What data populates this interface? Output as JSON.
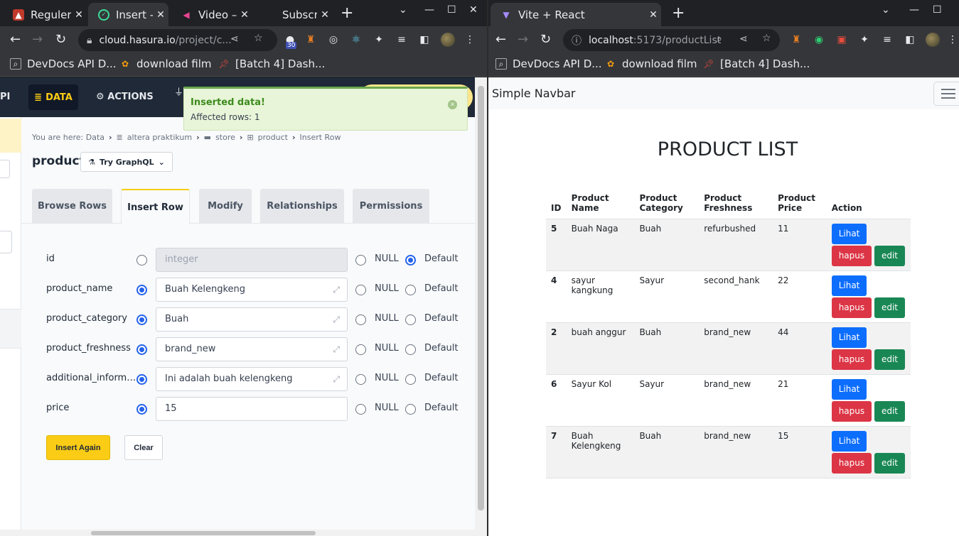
{
  "left_window": {
    "tabs": [
      {
        "title": "Reguler",
        "active": false
      },
      {
        "title": "Insert -",
        "active": true
      },
      {
        "title": "Video –",
        "active": false
      },
      {
        "title": "Subscri",
        "active": false
      }
    ],
    "url_main": "cloud.hasura.io",
    "url_rest": "/project/c...",
    "extension_badge": "30",
    "bookmarks": [
      "DevDocs API D...",
      "download film",
      "[Batch 4] Dash..."
    ]
  },
  "right_window": {
    "tabs": [
      {
        "title": "Vite + React",
        "active": true
      }
    ],
    "url_main": "localhost",
    "url_rest": ":5173/productList",
    "bookmarks": [
      "DevDocs API D...",
      "download film",
      "[Batch 4] Dash..."
    ]
  },
  "hasura": {
    "nav": {
      "api": "PI",
      "data": "DATA",
      "actions": "ACTIONS"
    },
    "toast": {
      "title": "Inserted data!",
      "message": "Affected rows: 1"
    },
    "breadcrumb": [
      "You are here: Data",
      "altera praktikum",
      "store",
      "product",
      "Insert Row"
    ],
    "table_title": "product",
    "try_graphql": "Try GraphQL",
    "tabs": [
      "Browse Rows",
      "Insert Row",
      "Modify",
      "Relationships",
      "Permissions"
    ],
    "active_tab": "Insert Row",
    "fields": [
      {
        "name": "id",
        "value": "",
        "placeholder": "integer",
        "mode": "Default"
      },
      {
        "name": "product_name",
        "value": "Buah Kelengkeng",
        "placeholder": "",
        "mode": "value"
      },
      {
        "name": "product_category",
        "value": "Buah",
        "placeholder": "",
        "mode": "value"
      },
      {
        "name": "product_freshness",
        "value": "brand_new",
        "placeholder": "",
        "mode": "value"
      },
      {
        "name": "additional_informat...",
        "value": "Ini adalah buah kelengkeng",
        "placeholder": "",
        "mode": "value"
      },
      {
        "name": "price",
        "value": "15",
        "placeholder": "",
        "mode": "value"
      }
    ],
    "null_label": "NULL",
    "default_label": "Default",
    "insert_again": "Insert Again",
    "clear": "Clear"
  },
  "react": {
    "brand": "Simple Navbar",
    "page_title": "PRODUCT LIST",
    "headers": [
      "ID",
      "Product Name",
      "Product Category",
      "Product Freshness",
      "Product Price",
      "Action"
    ],
    "rows": [
      {
        "id": "5",
        "name": "Buah Naga",
        "category": "Buah",
        "freshness": "refurbushed",
        "price": "11"
      },
      {
        "id": "4",
        "name": "sayur kangkung",
        "category": "Sayur",
        "freshness": "second_hank",
        "price": "22"
      },
      {
        "id": "2",
        "name": "buah anggur",
        "category": "Buah",
        "freshness": "brand_new",
        "price": "44"
      },
      {
        "id": "6",
        "name": "Sayur Kol",
        "category": "Sayur",
        "freshness": "brand_new",
        "price": "21"
      },
      {
        "id": "7",
        "name": "Buah Kelengkeng",
        "category": "Buah",
        "freshness": "brand_new",
        "price": "15"
      }
    ],
    "btn_lihat": "Lihat",
    "btn_hapus": "hapus",
    "btn_edit": "edit"
  },
  "colors": {
    "chrome_dark": "#202124",
    "chrome_toolbar": "#35363a",
    "hasura_nav": "#1f2937",
    "hasura_accent": "#facc15",
    "toast_green": "#3d8b1e",
    "bs_primary": "#0d6efd",
    "bs_danger": "#dc3545",
    "bs_success": "#198754"
  }
}
